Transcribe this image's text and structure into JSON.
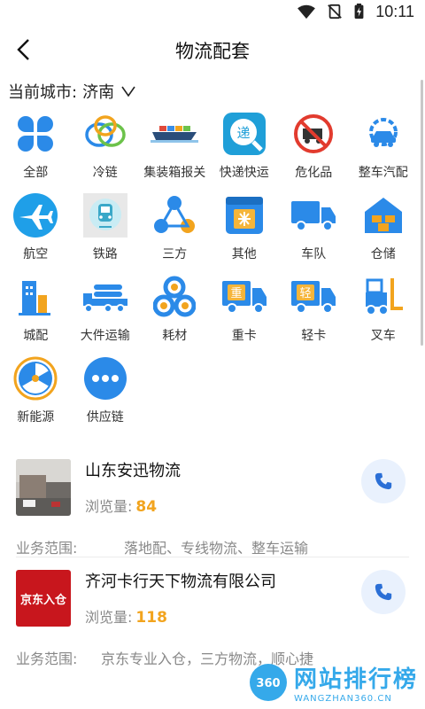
{
  "statusbar": {
    "time": "10:11"
  },
  "header": {
    "title": "物流配套"
  },
  "city": {
    "label": "当前城市:",
    "value": "济南"
  },
  "categories": [
    {
      "label": "全部",
      "icon": "clover-icon"
    },
    {
      "label": "冷链",
      "icon": "cold-chain-icon"
    },
    {
      "label": "集装箱报关",
      "icon": "container-ship-icon"
    },
    {
      "label": "快递快运",
      "icon": "express-icon"
    },
    {
      "label": "危化品",
      "icon": "hazmat-icon"
    },
    {
      "label": "整车汽配",
      "icon": "car-parts-icon"
    },
    {
      "label": "航空",
      "icon": "airplane-icon"
    },
    {
      "label": "铁路",
      "icon": "train-icon"
    },
    {
      "label": "三方",
      "icon": "share-icon"
    },
    {
      "label": "其他",
      "icon": "other-icon"
    },
    {
      "label": "车队",
      "icon": "truck-icon"
    },
    {
      "label": "仓储",
      "icon": "warehouse-icon"
    },
    {
      "label": "城配",
      "icon": "city-delivery-icon"
    },
    {
      "label": "大件运输",
      "icon": "heavy-truck-icon"
    },
    {
      "label": "耗材",
      "icon": "consumables-icon"
    },
    {
      "label": "重卡",
      "icon": "heavy-card-icon"
    },
    {
      "label": "轻卡",
      "icon": "light-card-icon"
    },
    {
      "label": "叉车",
      "icon": "forklift-icon"
    },
    {
      "label": "新能源",
      "icon": "radiation-icon"
    },
    {
      "label": "供应链",
      "icon": "more-icon"
    }
  ],
  "listings": [
    {
      "name": "山东安迅物流",
      "views_label": "浏览量:",
      "views": "84",
      "scope_label": "业务范围:",
      "scope": "落地配、专线物流、整车运输"
    },
    {
      "name": "齐河卡行天下物流有限公司",
      "views_label": "浏览量:",
      "views": "118",
      "scope_label": "业务范围:",
      "scope": "京东专业入仓，三方物流，顺心捷"
    }
  ],
  "thumb2_text": "京东入仓",
  "watermark": {
    "cn": "网站排行榜",
    "en": "WANGZHAN360.CN",
    "logo": "360"
  },
  "colors": {
    "accent": "#3a8ee6",
    "views": "#f2a41e",
    "phone_bg": "#e9f1fd"
  }
}
